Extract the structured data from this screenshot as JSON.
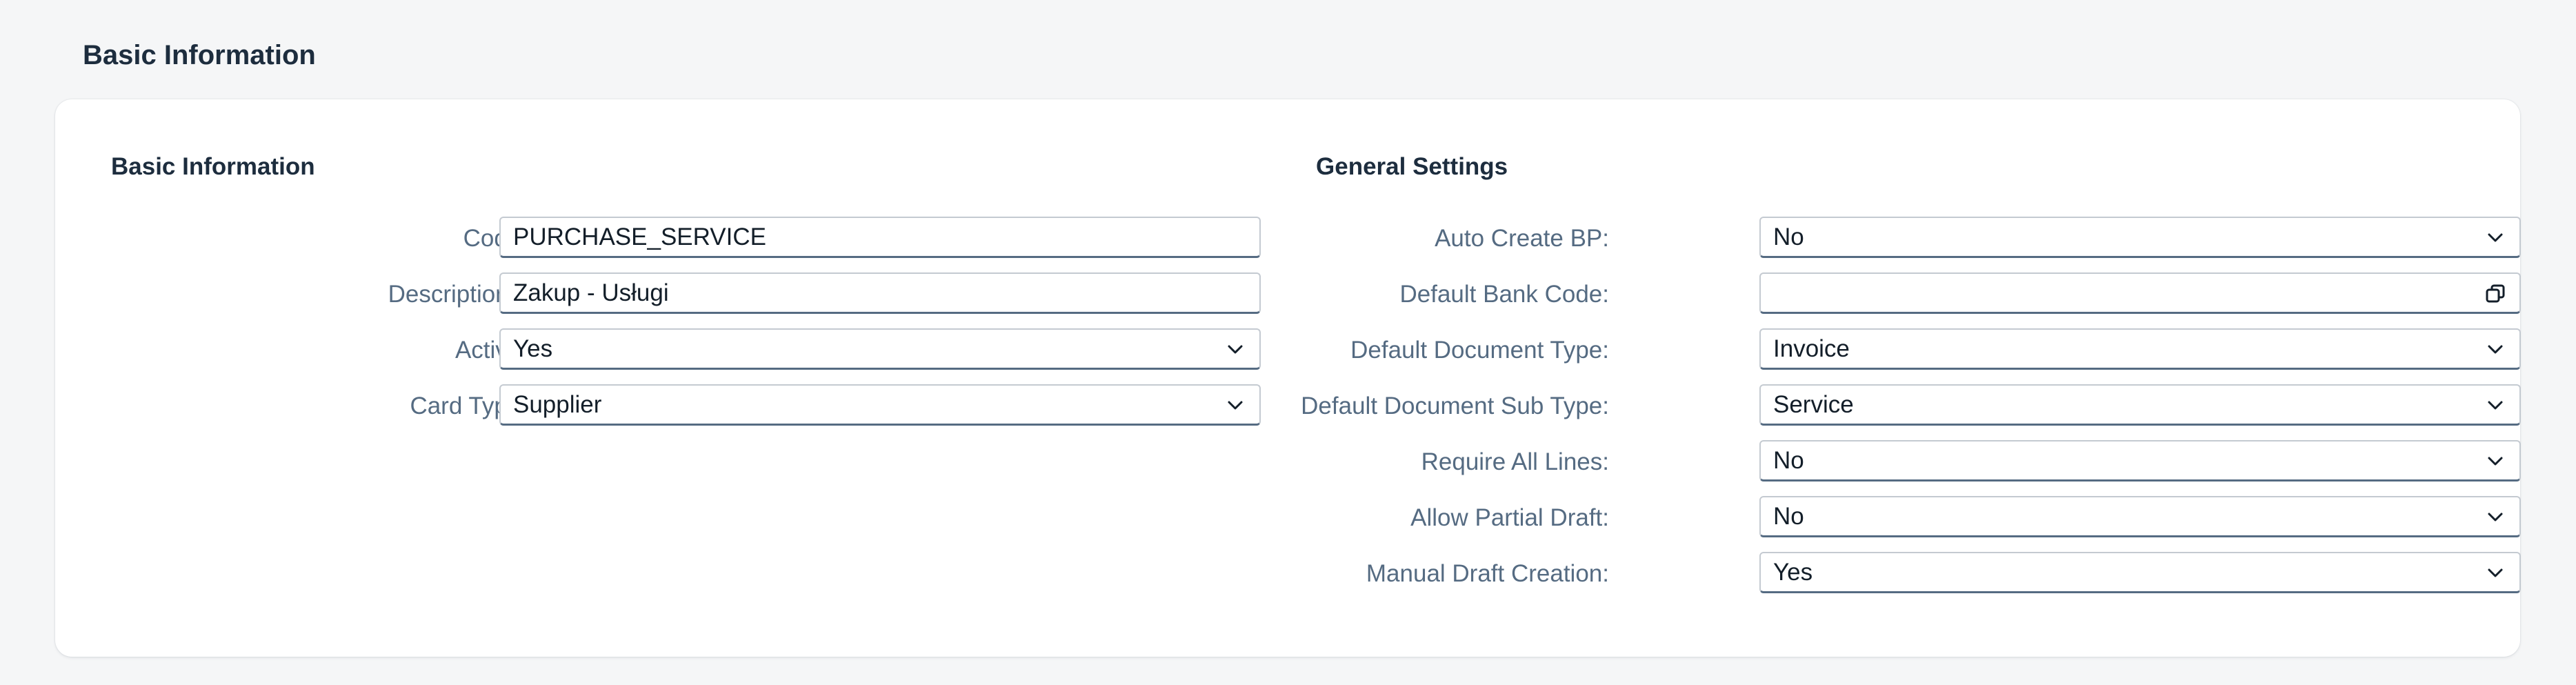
{
  "page": {
    "section_title": "Basic Information"
  },
  "basic_info": {
    "title": "Basic Information",
    "fields": {
      "code": {
        "label": "Code:",
        "value": "PURCHASE_SERVICE"
      },
      "description": {
        "label": "Description:",
        "required_mark": "*",
        "value": "Zakup - Usługi"
      },
      "active": {
        "label": "Active:",
        "value": "Yes"
      },
      "card_type": {
        "label": "Card Type:",
        "value": "Supplier"
      }
    }
  },
  "general_settings": {
    "title": "General Settings",
    "fields": {
      "auto_create_bp": {
        "label": "Auto Create BP:",
        "value": "No"
      },
      "default_bank_code": {
        "label": "Default Bank Code:",
        "value": ""
      },
      "default_document_type": {
        "label": "Default Document Type:",
        "value": "Invoice"
      },
      "default_document_sub_type": {
        "label": "Default Document Sub Type:",
        "value": "Service"
      },
      "require_all_lines": {
        "label": "Require All Lines:",
        "value": "No"
      },
      "allow_partial_draft": {
        "label": "Allow Partial Draft:",
        "value": "No"
      },
      "manual_draft_creation": {
        "label": "Manual Draft Creation:",
        "value": "Yes"
      }
    }
  },
  "icons": {
    "dropdown": "chevron-down-icon",
    "value_help": "value-help-icon"
  },
  "colors": {
    "background": "#f5f6f7",
    "card": "#ffffff",
    "label": "#556b82",
    "required": "#aa0808",
    "field_border": "#c4cad1",
    "field_bottom_border": "#556b82"
  }
}
